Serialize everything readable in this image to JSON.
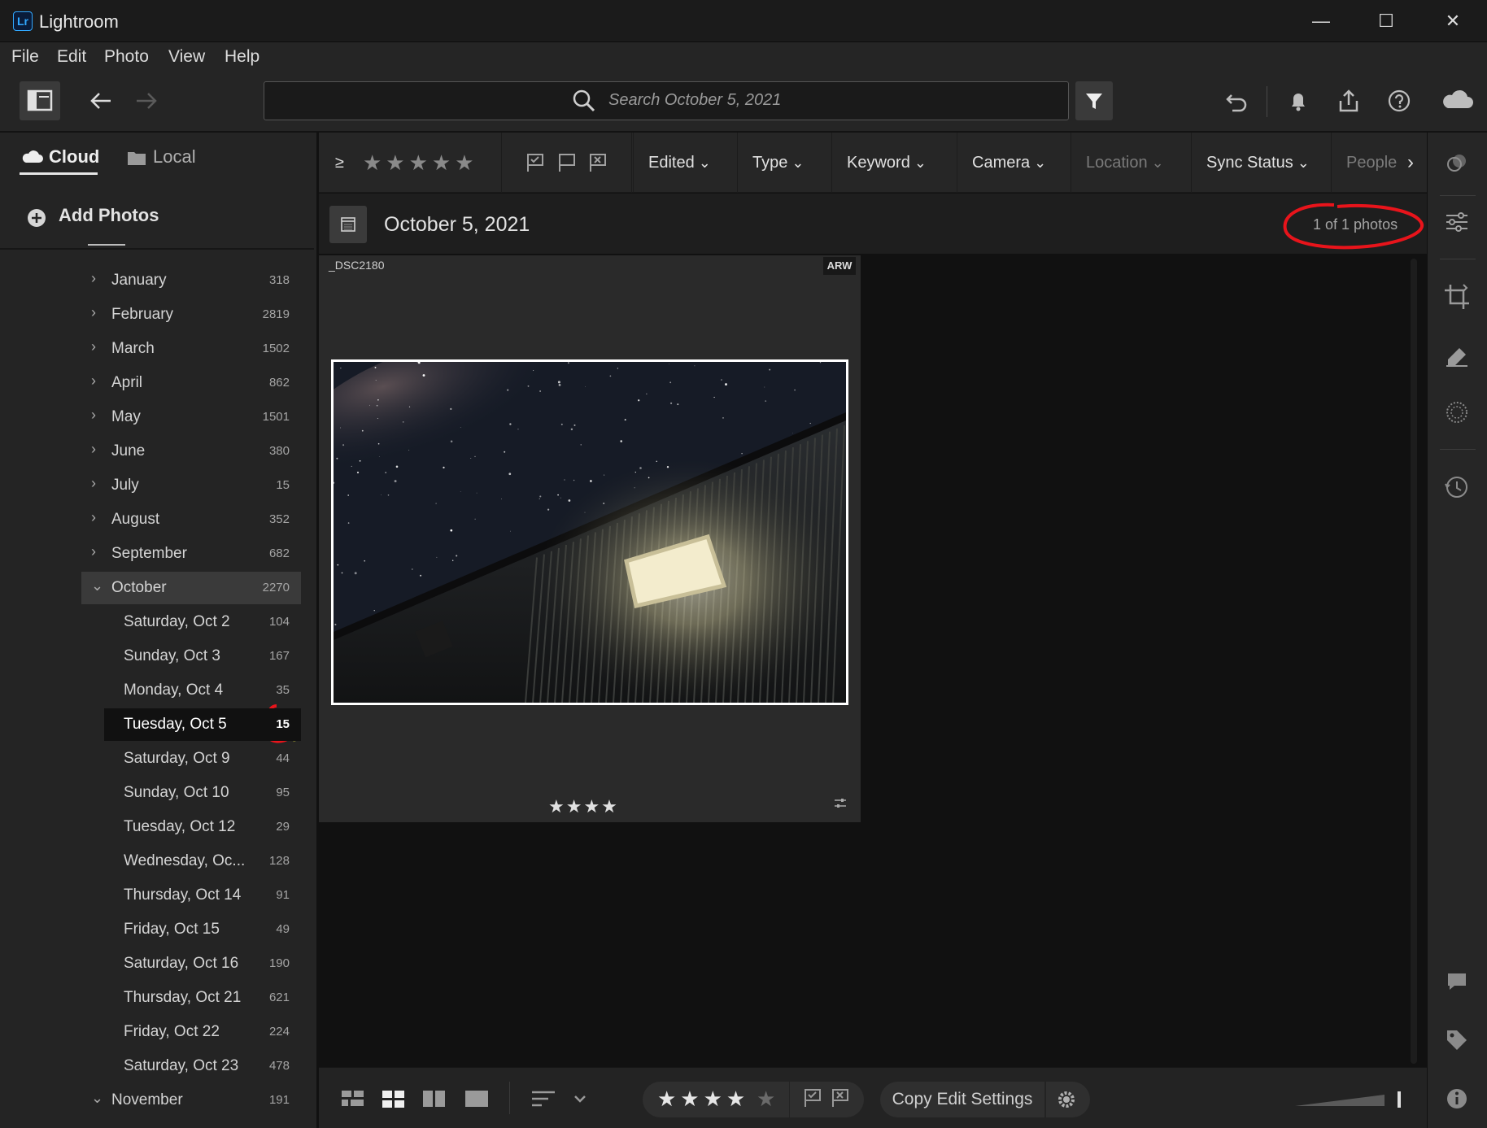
{
  "app": {
    "title": "Lightroom",
    "logo_text": "Lr"
  },
  "window_controls": {
    "minimize": "—",
    "maximize": "☐",
    "close": "✕"
  },
  "menu": [
    "File",
    "Edit",
    "Photo",
    "View",
    "Help"
  ],
  "search": {
    "placeholder": "Search October 5, 2021"
  },
  "source_tabs": {
    "cloud": "Cloud",
    "local": "Local"
  },
  "add_photos": "Add Photos",
  "filter_bar": {
    "rating_op": "≥",
    "rating_stars": "★★★★★",
    "dropdowns": [
      "Edited",
      "Type",
      "Keyword",
      "Camera",
      "Location",
      "Sync Status",
      "People"
    ]
  },
  "date_header": {
    "title": "October 5, 2021",
    "count": "1 of 1 photos"
  },
  "photo": {
    "filename": "_DSC2180",
    "badge": "ARW",
    "stars": "★★★★"
  },
  "tree": {
    "months": [
      {
        "label": "January",
        "count": "318"
      },
      {
        "label": "February",
        "count": "2819"
      },
      {
        "label": "March",
        "count": "1502"
      },
      {
        "label": "April",
        "count": "862"
      },
      {
        "label": "May",
        "count": "1501"
      },
      {
        "label": "June",
        "count": "380"
      },
      {
        "label": "July",
        "count": "15"
      },
      {
        "label": "August",
        "count": "352"
      },
      {
        "label": "September",
        "count": "682"
      },
      {
        "label": "October",
        "count": "2270"
      }
    ],
    "october_days": [
      {
        "label": "Saturday, Oct 2",
        "count": "104"
      },
      {
        "label": "Sunday, Oct 3",
        "count": "167"
      },
      {
        "label": "Monday, Oct 4",
        "count": "35"
      },
      {
        "label": "Tuesday, Oct 5",
        "count": "15"
      },
      {
        "label": "Saturday, Oct 9",
        "count": "44"
      },
      {
        "label": "Sunday, Oct 10",
        "count": "95"
      },
      {
        "label": "Tuesday, Oct 12",
        "count": "29"
      },
      {
        "label": "Wednesday, Oc...",
        "count": "128"
      },
      {
        "label": "Thursday, Oct 14",
        "count": "91"
      },
      {
        "label": "Friday, Oct 15",
        "count": "49"
      },
      {
        "label": "Saturday, Oct 16",
        "count": "190"
      },
      {
        "label": "Thursday, Oct 21",
        "count": "621"
      },
      {
        "label": "Friday, Oct 22",
        "count": "224"
      },
      {
        "label": "Saturday, Oct 23",
        "count": "478"
      }
    ],
    "november": {
      "label": "November",
      "count": "191"
    }
  },
  "bottom_bar": {
    "stars": "★★★★",
    "star_empty": "★",
    "copy_edit": "Copy Edit Settings"
  },
  "colors": {
    "accent_blue": "#31a8ff",
    "annotation_red": "#e8141b",
    "selected_bg": "#111111"
  }
}
